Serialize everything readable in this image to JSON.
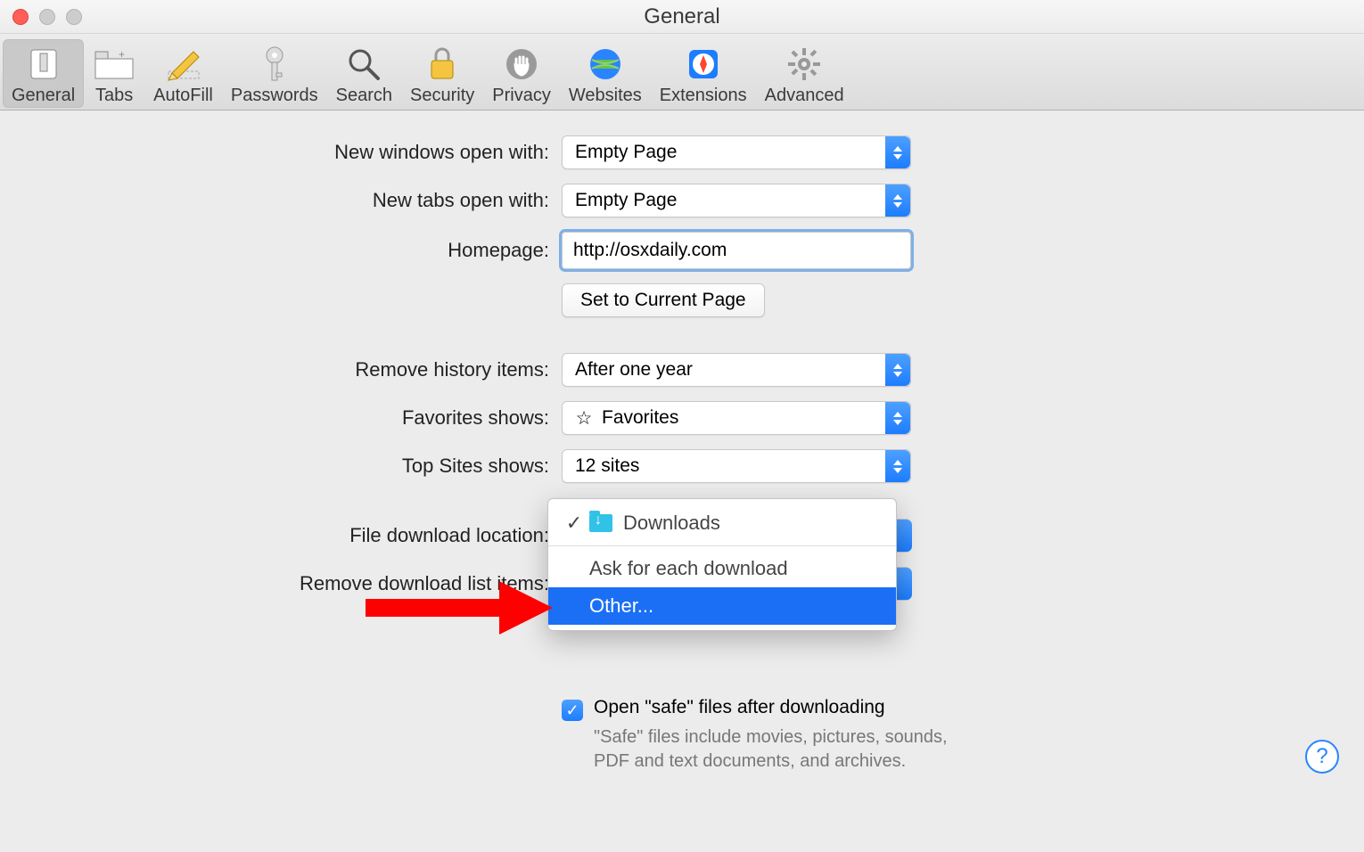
{
  "window": {
    "title": "General"
  },
  "toolbar": {
    "items": [
      {
        "label": "General"
      },
      {
        "label": "Tabs"
      },
      {
        "label": "AutoFill"
      },
      {
        "label": "Passwords"
      },
      {
        "label": "Search"
      },
      {
        "label": "Security"
      },
      {
        "label": "Privacy"
      },
      {
        "label": "Websites"
      },
      {
        "label": "Extensions"
      },
      {
        "label": "Advanced"
      }
    ]
  },
  "labels": {
    "new_windows": "New windows open with:",
    "new_tabs": "New tabs open with:",
    "homepage": "Homepage:",
    "set_current": "Set to Current Page",
    "remove_history": "Remove history items:",
    "favorites_shows": "Favorites shows:",
    "top_sites_shows": "Top Sites shows:",
    "file_dl_location": "File download location:",
    "remove_dl_list": "Remove download list items:",
    "open_safe": "Open \"safe\" files after downloading",
    "safe_desc": "\"Safe\" files include movies, pictures, sounds, PDF and text documents, and archives."
  },
  "values": {
    "new_windows": "Empty Page",
    "new_tabs": "Empty Page",
    "homepage": "http://osxdaily.com",
    "remove_history": "After one year",
    "favorites_shows": "Favorites",
    "top_sites_shows": "12 sites"
  },
  "download_menu": {
    "checked": "Downloads",
    "ask": "Ask for each download",
    "other": "Other..."
  },
  "help": "?"
}
